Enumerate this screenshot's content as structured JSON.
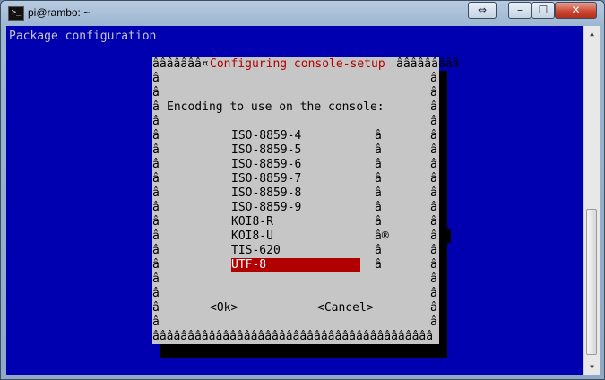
{
  "window": {
    "title": "pi@rambo: ~",
    "app_icon": "terminal-icon"
  },
  "controls": {
    "restore": "⇔",
    "minimize": "–",
    "maximize": "☐",
    "close": "✕"
  },
  "terminal": {
    "header": "Package configuration"
  },
  "dialog": {
    "title_left": "âââââââ¤",
    "title": "Configuring console-setup",
    "title_right": "âââââââââ",
    "border_char": "â",
    "prompt": "Encoding to use on the console:",
    "items": [
      {
        "label": "ISO-8859-4",
        "mark": "â"
      },
      {
        "label": "ISO-8859-5",
        "mark": "â"
      },
      {
        "label": "ISO-8859-6",
        "mark": "â"
      },
      {
        "label": "ISO-8859-7",
        "mark": "â"
      },
      {
        "label": "ISO-8859-8",
        "mark": "â"
      },
      {
        "label": "ISO-8859-9",
        "mark": "â"
      },
      {
        "label": "KOI8-R",
        "mark": "â"
      },
      {
        "label": "KOI8-U",
        "mark": "â®"
      },
      {
        "label": "TIS-620",
        "mark": "â"
      },
      {
        "label": "UTF-8",
        "mark": "â",
        "selected": true
      }
    ],
    "ok": "<Ok>",
    "cancel": "<Cancel>",
    "bottom": "ââââââââââââââââââââââââââââââââââââââââ"
  },
  "colors": {
    "terminal_bg": "#0000b0",
    "dialog_bg": "#c6c6c6",
    "title": "#b00000",
    "selection": "#b00000"
  }
}
